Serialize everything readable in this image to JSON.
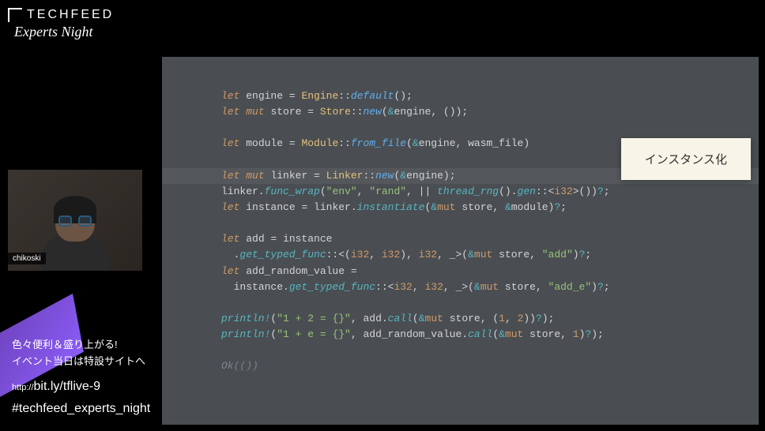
{
  "logo": {
    "brand": "TECHFEED",
    "subtitle": "Experts Night"
  },
  "webcam": {
    "username": "chikoski"
  },
  "callout": {
    "text": "インスタンス化"
  },
  "footer": {
    "line1": "色々便利＆盛り上がる!",
    "line2": "イベント当日は特設サイトへ",
    "url_prefix": "http://",
    "url": "bit.ly/tflive-9",
    "hashtag": "#techfeed_experts_night"
  },
  "code": {
    "l1": {
      "let": "let",
      "v": "engine",
      "eq": " = ",
      "t": "Engine",
      "sep": "::",
      "fn": "default",
      "rest": "();"
    },
    "l2": {
      "let": "let",
      "mut": "mut",
      "v": "store",
      "eq": " = ",
      "t": "Store",
      "sep": "::",
      "fn": "new",
      "open": "(",
      "amp": "&",
      "arg": "engine, ()",
      "close": ");"
    },
    "l3": {
      "let": "let",
      "v": "module",
      "eq": " = ",
      "t": "Module",
      "sep": "::",
      "fn": "from_file",
      "open": "(",
      "amp": "&",
      "args": "engine, wasm_file)"
    },
    "l4": {
      "let": "let",
      "mut": "mut",
      "v": "linker",
      "eq": " = ",
      "t": "Linker",
      "sep": "::",
      "fn": "new",
      "open": "(",
      "amp": "&",
      "arg": "engine);"
    },
    "l5": {
      "obj": "linker.",
      "fn": "func_wrap",
      "open": "(",
      "s1": "\"env\"",
      "c1": ", ",
      "s2": "\"rand\"",
      "c2": ", || ",
      "call": "thread_rng",
      "rest1": "().",
      "gen": "gen",
      "tt": "::<",
      "i32": "i32",
      "tt2": ">())",
      "q": "?",
      "semi": ";"
    },
    "l6": {
      "let": "let",
      "v": "instance",
      "eq": " = linker.",
      "fn": "instantiate",
      "open": "(",
      "amp": "&",
      "mut": "mut",
      "args": " store, ",
      "amp2": "&",
      "args2": "module)",
      "q": "?",
      "semi": ";"
    },
    "l7": {
      "let": "let",
      "v": "add",
      "eq": " = instance"
    },
    "l8": {
      "ind": "  .",
      "fn": "get_typed_func",
      "tt": "::<(",
      "i32a": "i32",
      "c": ", ",
      "i32b": "i32",
      "mid": "), ",
      "i32c": "i32",
      "end": ", _>(",
      "amp": "&",
      "mut": "mut",
      "args": " store, ",
      "s": "\"add\"",
      "close": ")",
      "q": "?",
      "semi": ";"
    },
    "l9": {
      "let": "let",
      "v": "add_random_value",
      "eq": " ="
    },
    "l10": {
      "ind": "  instance.",
      "fn": "get_typed_func",
      "tt": "::<",
      "i32a": "i32",
      "c": ", ",
      "i32b": "i32",
      "end": ", _>(",
      "amp": "&",
      "mut": "mut",
      "args": " store, ",
      "s": "\"add_e\"",
      "close": ")",
      "q": "?",
      "semi": ";"
    },
    "l11": {
      "mac": "println!",
      "open": "(",
      "s": "\"1 + 2 = {}\"",
      "c": ", add.",
      "fn": "call",
      "open2": "(",
      "amp": "&",
      "mut": "mut",
      "args": " store, (",
      "n1": "1",
      "cm": ", ",
      "n2": "2",
      "close": "))",
      "q": "?",
      "end": ");"
    },
    "l12": {
      "mac": "println!",
      "open": "(",
      "s": "\"1 + e = {}\"",
      "c": ", add_random_value.",
      "fn": "call",
      "open2": "(",
      "amp": "&",
      "mut": "mut",
      "args": " store, ",
      "n": "1",
      "close": ")",
      "q": "?",
      "end": ");"
    },
    "l13": {
      "ok": "Ok",
      "rest": "(())"
    }
  }
}
